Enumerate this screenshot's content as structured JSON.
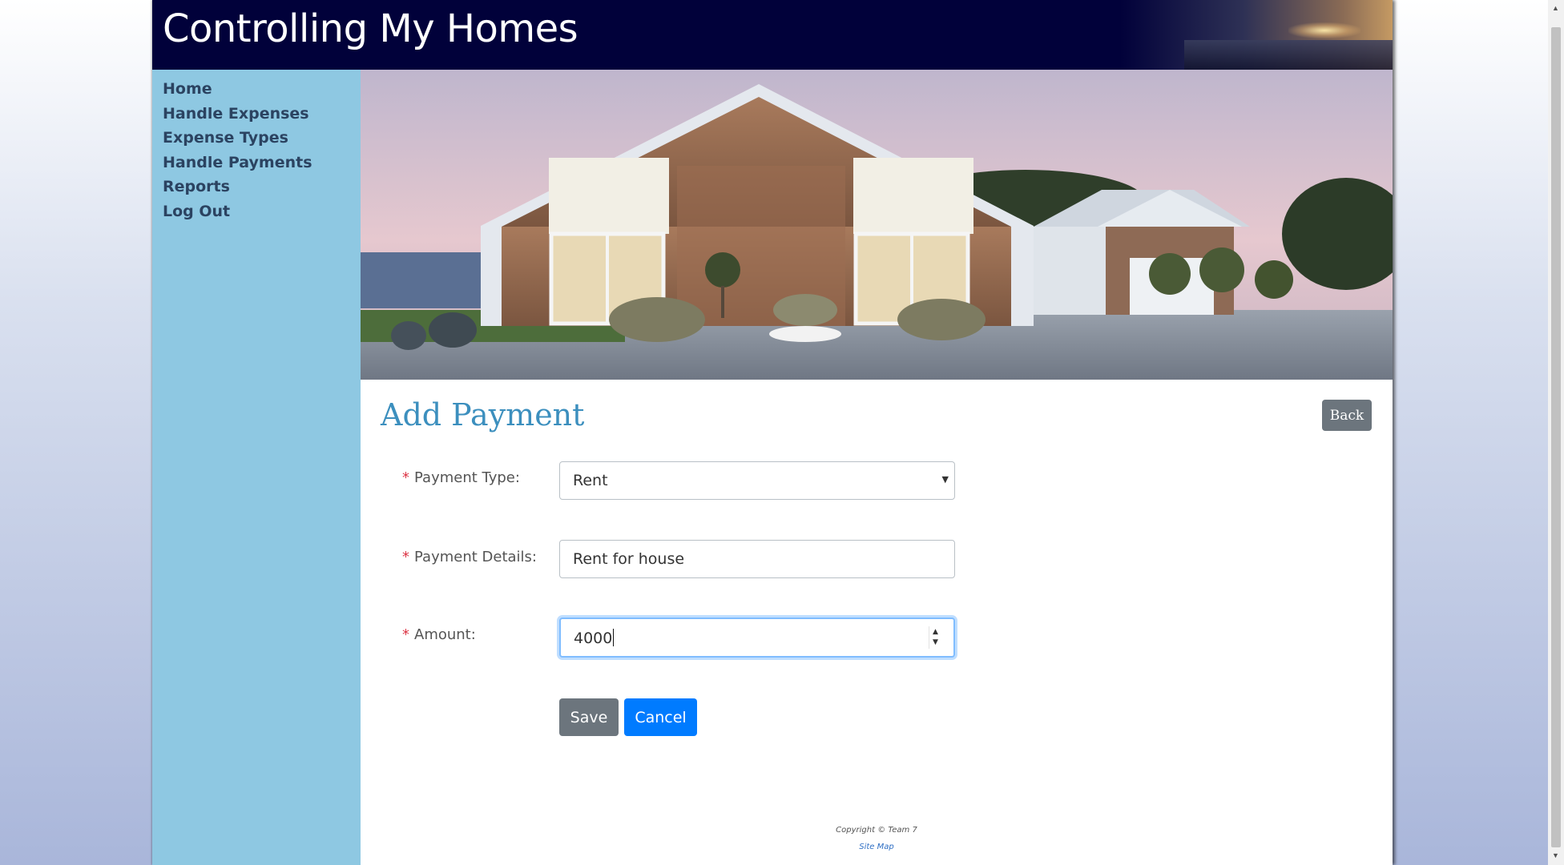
{
  "site": {
    "title": "Controlling My Homes"
  },
  "nav": [
    {
      "label": "Home"
    },
    {
      "label": "Handle Expenses"
    },
    {
      "label": "Expense Types"
    },
    {
      "label": "Handle Payments"
    },
    {
      "label": "Reports"
    },
    {
      "label": "Log Out"
    }
  ],
  "form": {
    "title": "Add Payment",
    "back_label": "Back",
    "required_mark": "*",
    "payment_type": {
      "label": "Payment Type:",
      "value": "Rent"
    },
    "payment_details": {
      "label": "Payment Details:",
      "value": "Rent for house"
    },
    "amount": {
      "label": "Amount:",
      "value": "4000"
    },
    "save_label": "Save",
    "cancel_label": "Cancel"
  },
  "footer": {
    "copyright": "Copyright © Team 7",
    "sitemap": "Site Map"
  },
  "colors": {
    "header_bg": "#01013a",
    "sidebar_bg": "#8ec8e2",
    "nav_text": "#2b4361",
    "title_accent": "#3c8fbe",
    "primary_button": "#007bff",
    "secondary_button": "#6c757d",
    "required_mark": "#dc3545"
  },
  "icons": {
    "select_arrow": "chevron-down-icon",
    "number_spinner": "spinner-icon"
  }
}
